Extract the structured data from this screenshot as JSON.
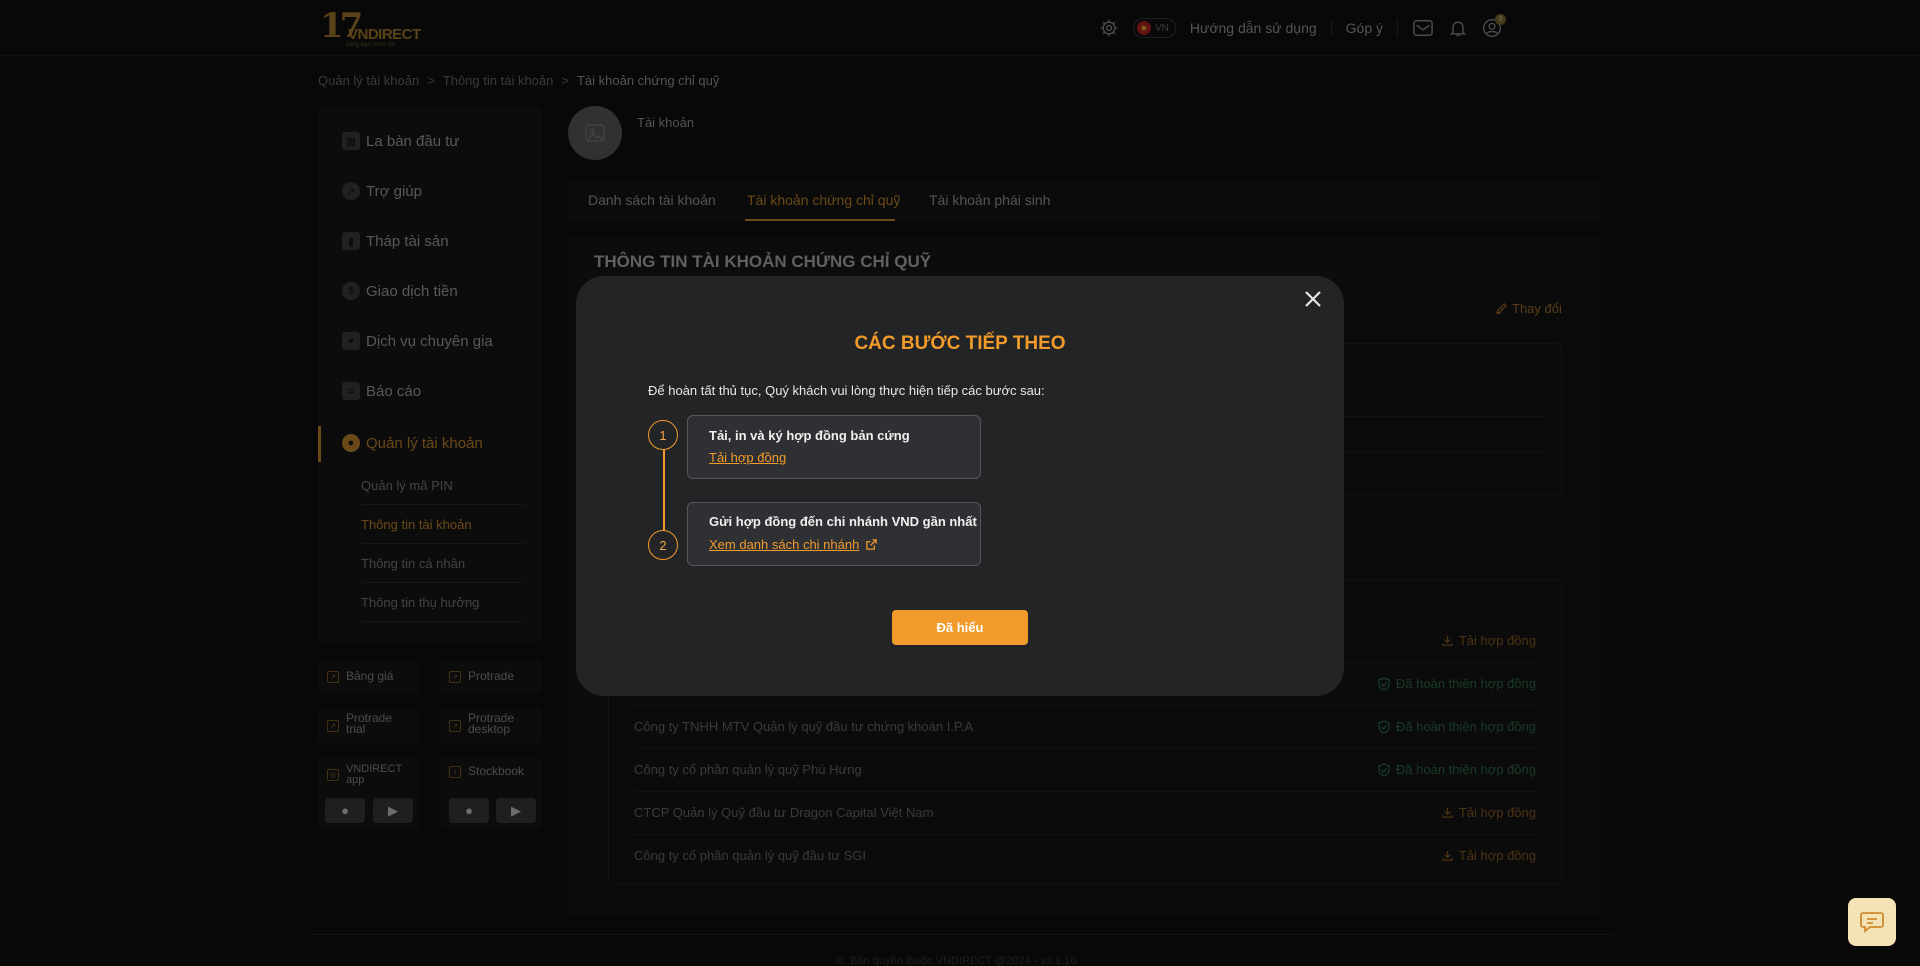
{
  "header": {
    "logo_number": "17",
    "logo_brand": "VNDIRECT",
    "logo_tagline": "cùng bạn vươn tới",
    "lang": "VN",
    "guide": "Hướng dẫn sử dụng",
    "feedback": "Góp ý",
    "notif_count": "0"
  },
  "breadcrumb": [
    "Quản lý tài khoản",
    ">",
    "Thông tin tài khoản",
    ">",
    "Tài khoản chứng chỉ quỹ"
  ],
  "sidebar": {
    "items": [
      {
        "label": "La bàn đầu tư",
        "icon": "dashboard-icon"
      },
      {
        "label": "Trợ giúp",
        "icon": "compass-icon"
      },
      {
        "label": "Tháp tài sản",
        "icon": "book-icon"
      },
      {
        "label": "Giao dịch tiền",
        "icon": "coin-icon"
      },
      {
        "label": "Dịch vụ chuyên gia",
        "icon": "expert-icon"
      },
      {
        "label": "Báo cáo",
        "icon": "report-icon"
      },
      {
        "label": "Quản lý tài khoản",
        "icon": "user-icon"
      }
    ],
    "subitems": [
      "Quản lý mã PIN",
      "Thông tin tài khoản",
      "Thông tin cá nhân",
      "Thông tin thụ hưởng"
    ]
  },
  "tiles": {
    "bang_gia": "Bảng giá",
    "protrade": "Protrade",
    "protrade_trial_1": "Protrade",
    "protrade_trial_2": "trial",
    "protrade_desktop_1": "Protrade",
    "protrade_desktop_2": "desktop",
    "vndirect_app_1": "VNDIRECT",
    "vndirect_app_2": "app",
    "stockbook": "Stockbook"
  },
  "account": {
    "label": "Tài khoản"
  },
  "tabs": [
    "Danh sách tài khoản",
    "Tài khoản chứng chỉ quỹ",
    "Tài khoản phái sinh"
  ],
  "panel": {
    "title": "THÔNG TIN TÀI KHOẢN CHỨNG CHỈ QUỸ",
    "change": "Thay đổi"
  },
  "fund_rows": [
    {
      "name": "",
      "status": "Tải hợp đồng",
      "type": "download"
    },
    {
      "name": "",
      "status": "Đã hoàn thiện hợp đồng",
      "type": "done"
    },
    {
      "name": "Công ty TNHH MTV Quản lý quỹ đầu tư chứng khoán I.P.A",
      "status": "Đã hoàn thiện hợp đồng",
      "type": "done"
    },
    {
      "name": "Công ty cổ phần quản lý quỹ Phú Hưng",
      "status": "Đã hoàn thiện hợp đồng",
      "type": "done"
    },
    {
      "name": "CTCP Quản lý Quỹ đầu tư Dragon Capital Việt Nam",
      "status": "Tải hợp đồng",
      "type": "download"
    },
    {
      "name": "Công ty cổ phần quản lý quỹ đầu tư SGI",
      "status": "Tải hợp đồng",
      "type": "download"
    }
  ],
  "footer": "Bản quyền thuộc VNDIRECT @2024 - v3.1.16",
  "modal": {
    "title": "CÁC BƯỚC TIẾP THEO",
    "intro": "Để hoàn tất thủ tục, Quý khách vui lòng thực hiện tiếp các bước sau:",
    "steps": [
      {
        "num": "1",
        "title": "Tải, in và ký hợp đồng bản cứng",
        "link": "Tải hợp đồng"
      },
      {
        "num": "2",
        "title": "Gửi hợp đồng đến chi nhánh VND gần nhất",
        "link": "Xem danh sách chi nhánh"
      }
    ],
    "confirm": "Đã hiểu"
  },
  "colors": {
    "accent": "#f19b2c",
    "accent_dim": "#c2852c",
    "done_green": "#2d6b48"
  }
}
